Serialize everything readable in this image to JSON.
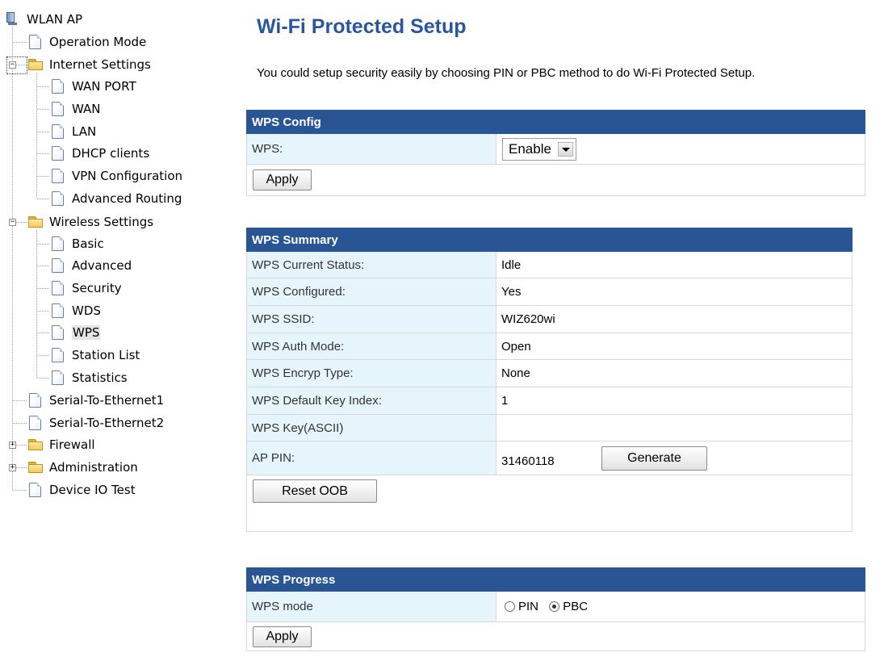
{
  "tree": {
    "root": "WLAN AP",
    "items": [
      {
        "label": "Operation Mode"
      },
      {
        "label": "Internet Settings"
      },
      {
        "label": "WAN PORT"
      },
      {
        "label": "WAN"
      },
      {
        "label": "LAN"
      },
      {
        "label": "DHCP clients"
      },
      {
        "label": "VPN Configuration"
      },
      {
        "label": "Advanced Routing"
      },
      {
        "label": "Wireless Settings"
      },
      {
        "label": "Basic"
      },
      {
        "label": "Advanced"
      },
      {
        "label": "Security"
      },
      {
        "label": "WDS"
      },
      {
        "label": "WPS"
      },
      {
        "label": "Station List"
      },
      {
        "label": "Statistics"
      },
      {
        "label": "Serial-To-Ethernet1"
      },
      {
        "label": "Serial-To-Ethernet2"
      },
      {
        "label": "Firewall"
      },
      {
        "label": "Administration"
      },
      {
        "label": "Device IO Test"
      }
    ],
    "expander_minus": "−",
    "expander_plus": "+"
  },
  "page": {
    "title": "Wi-Fi Protected Setup",
    "intro": "You could setup security easily by choosing PIN or PBC method to do Wi-Fi Protected Setup."
  },
  "wps_config": {
    "header": "WPS Config",
    "wps_label": "WPS:",
    "wps_value": "Enable",
    "apply_label": "Apply"
  },
  "wps_summary": {
    "header": "WPS Summary",
    "rows": [
      {
        "label": "WPS Current Status:",
        "value": "Idle"
      },
      {
        "label": "WPS Configured:",
        "value": "Yes"
      },
      {
        "label": "WPS SSID:",
        "value": "WIZ620wi"
      },
      {
        "label": "WPS Auth Mode:",
        "value": "Open"
      },
      {
        "label": "WPS Encryp Type:",
        "value": "None"
      },
      {
        "label": "WPS Default Key Index:",
        "value": "1"
      },
      {
        "label": "WPS Key(ASCII)",
        "value": ""
      },
      {
        "label": "AP PIN:",
        "value": "31460118"
      }
    ],
    "generate_label": "Generate",
    "reset_label": "Reset OOB"
  },
  "wps_progress": {
    "header": "WPS Progress",
    "mode_label": "WPS mode",
    "option_pin": "PIN",
    "option_pbc": "PBC",
    "apply_label": "Apply"
  },
  "colors": {
    "title": "#2a56a0",
    "table_header": "#2a5594",
    "label_cell": "#e6f4fc"
  }
}
